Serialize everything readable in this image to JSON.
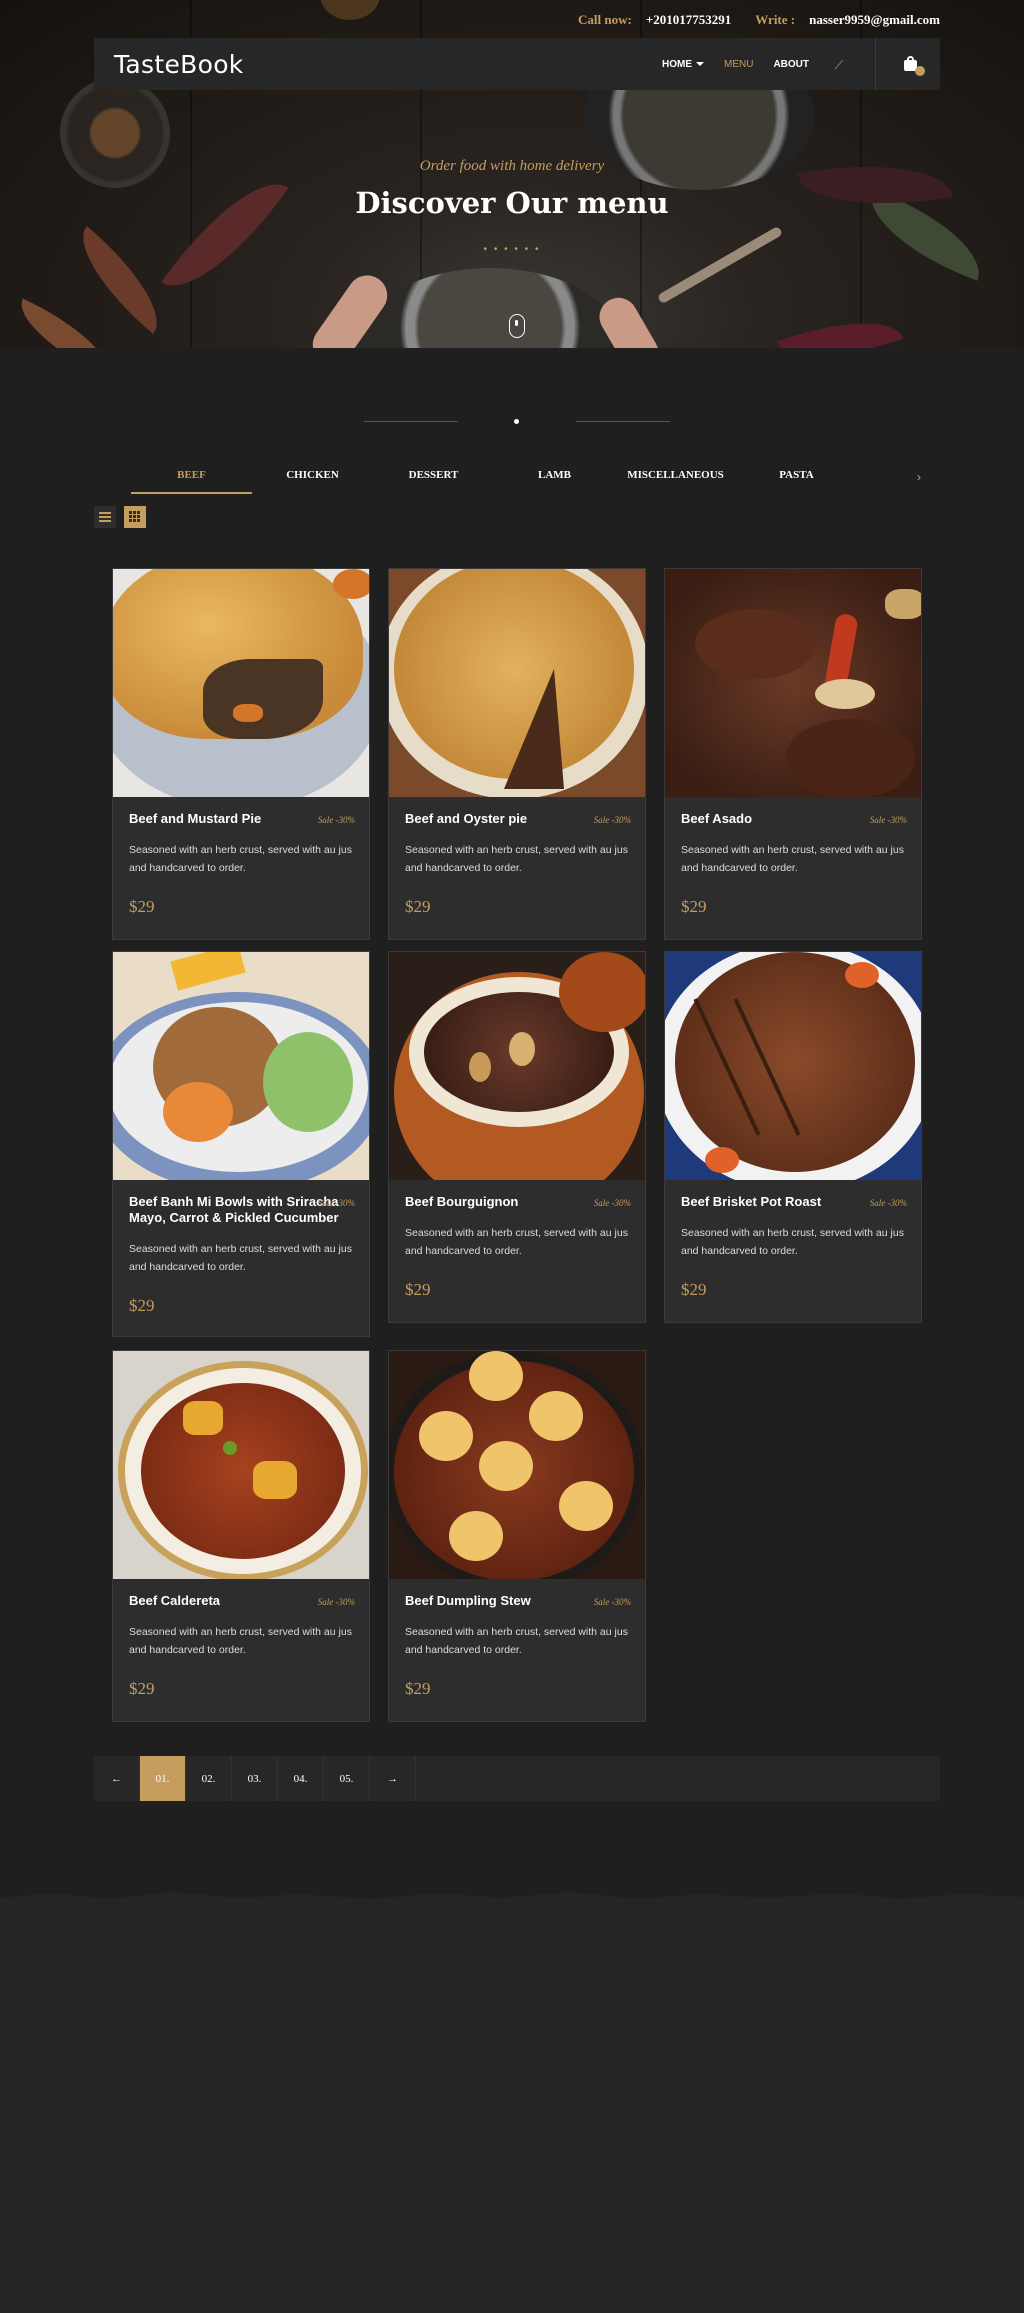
{
  "topbar": {
    "call_label": "Call now:",
    "phone": "+201017753291",
    "write_label": "Write :",
    "email": "nasser9959@gmail.com"
  },
  "nav": {
    "logo": "TasteBook",
    "links": [
      "HOME",
      "MENU",
      "ABOUT"
    ],
    "active": "MENU"
  },
  "hero": {
    "subtitle": "Order food with home delivery",
    "title": "Discover Our menu"
  },
  "tabs": [
    "BEEF",
    "CHICKEN",
    "DESSERT",
    "LAMB",
    "MISCELLANEOUS",
    "PASTA"
  ],
  "active_tab": "BEEF",
  "tab_next_icon": "chevron-right-icon",
  "products": [
    {
      "name": "Beef and Mustard Pie",
      "sale": "Sale -30%",
      "desc": "Seasoned with an herb crust, served with au jus and handcarved to order.",
      "price": "$29"
    },
    {
      "name": "Beef and Oyster pie",
      "sale": "Sale -30%",
      "desc": "Seasoned with an herb crust, served with au jus and handcarved to order.",
      "price": "$29"
    },
    {
      "name": "Beef Asado",
      "sale": "Sale -30%",
      "desc": "Seasoned with an herb crust, served with au jus and handcarved to order.",
      "price": "$29"
    },
    {
      "name": "Beef Banh Mi Bowls with Sriracha Mayo, Carrot & Pickled Cucumber",
      "sale": "Sale -30%",
      "desc": "Seasoned with an herb crust, served with au jus and handcarved to order.",
      "price": "$29"
    },
    {
      "name": "Beef Bourguignon",
      "sale": "Sale -30%",
      "desc": "Seasoned with an herb crust, served with au jus and handcarved to order.",
      "price": "$29"
    },
    {
      "name": "Beef Brisket Pot Roast",
      "sale": "Sale -30%",
      "desc": "Seasoned with an herb crust, served with au jus and handcarved to order.",
      "price": "$29"
    },
    {
      "name": "Beef Caldereta",
      "sale": "Sale -30%",
      "desc": "Seasoned with an herb crust, served with au jus and handcarved to order.",
      "price": "$29"
    },
    {
      "name": "Beef Dumpling Stew",
      "sale": "Sale -30%",
      "desc": "Seasoned with an herb crust, served with au jus and handcarved to order.",
      "price": "$29"
    }
  ],
  "pagination": {
    "prev": "←",
    "pages": [
      "01.",
      "02.",
      "03.",
      "04.",
      "05."
    ],
    "active": "01.",
    "next": "→"
  },
  "colors": {
    "accent": "#c59d5f",
    "background": "#1f1f1f",
    "card": "#2d2d2d"
  }
}
